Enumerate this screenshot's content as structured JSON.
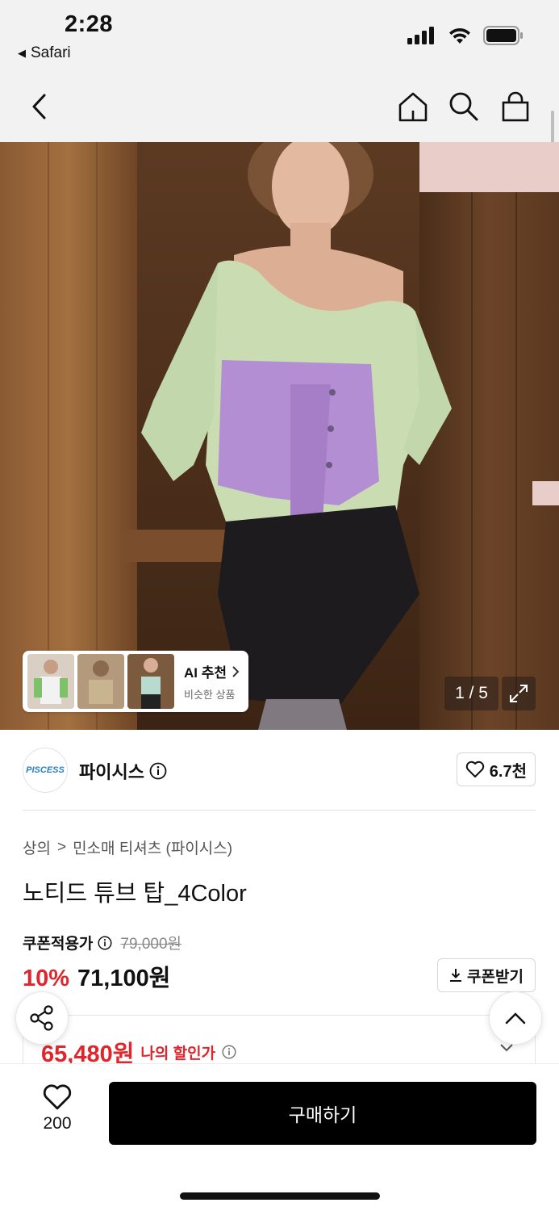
{
  "status_bar": {
    "time": "2:28",
    "back_app": "Safari"
  },
  "nav": {
    "back_icon": "chevron-left-icon",
    "home_icon": "home-icon",
    "search_icon": "search-icon",
    "cart_icon": "shopping-bag-icon"
  },
  "hero": {
    "pager": "1 / 5",
    "ai_card": {
      "title": "AI 추천",
      "subtitle": "비슷한 상품"
    }
  },
  "brand": {
    "logo_text": "PISCESS",
    "name": "파이시스",
    "likes": "6.7천"
  },
  "breadcrumb": {
    "category": "상의",
    "separator": ">",
    "subcategory": "민소매 티셔츠 (파이시스)"
  },
  "product": {
    "title": "노티드 튜브 탑_4Color"
  },
  "pricing": {
    "coupon_label": "쿠폰적용가",
    "original_price": "79,000원",
    "discount": "10%",
    "sale_price": "71,100원",
    "coupon_button": "쿠폰받기",
    "my_price": "65,480원",
    "my_price_label": "나의 할인가"
  },
  "bottom_bar": {
    "like_count": "200",
    "buy_label": "구매하기"
  },
  "colors": {
    "accent_red": "#e0262c",
    "buy_button": "#000000"
  }
}
